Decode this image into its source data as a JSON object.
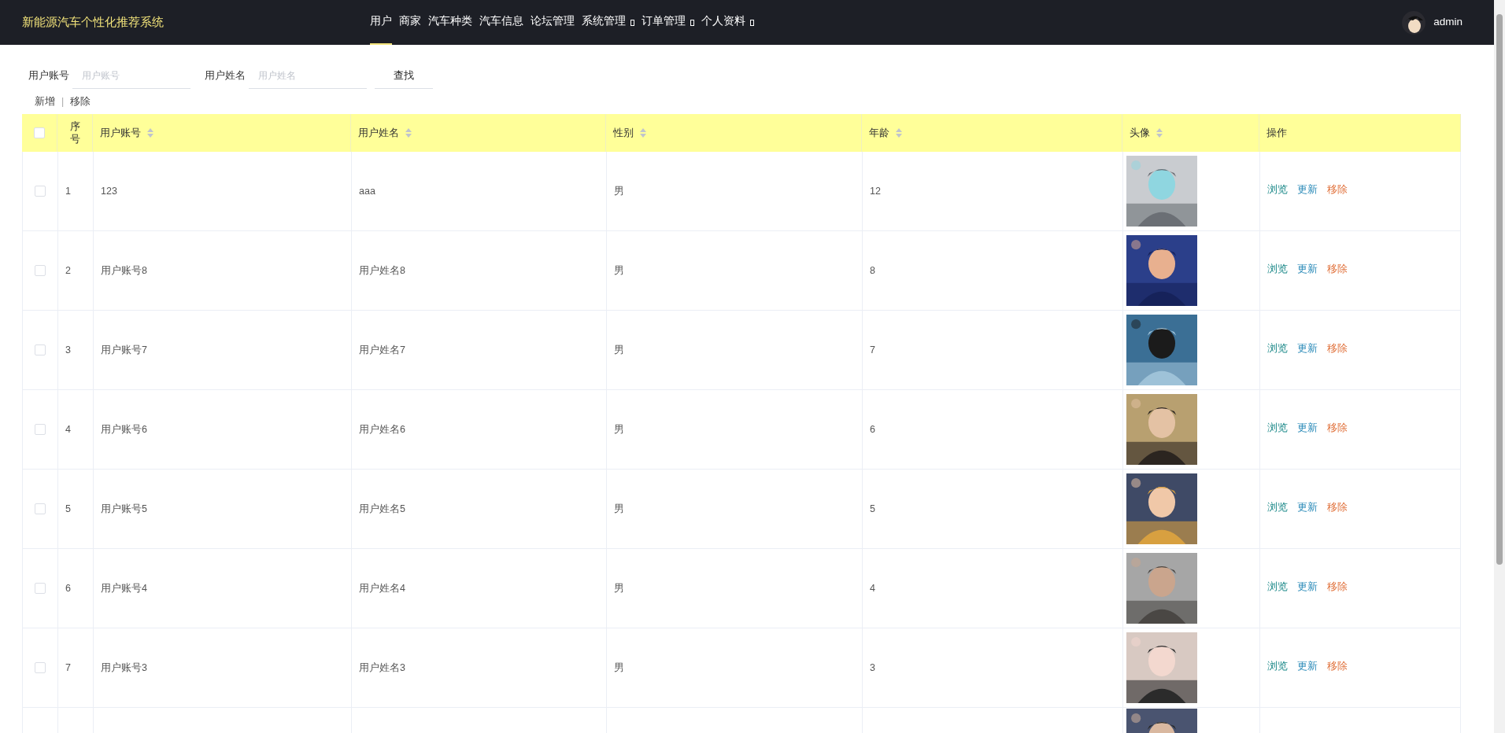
{
  "header": {
    "title": "新能源汽车个性化推荐系统",
    "nav": [
      {
        "label": "用户",
        "selected": true,
        "has_menu": false
      },
      {
        "label": "商家",
        "selected": false,
        "has_menu": false
      },
      {
        "label": "汽车种类",
        "selected": false,
        "has_menu": false
      },
      {
        "label": "汽车信息",
        "selected": false,
        "has_menu": false
      },
      {
        "label": "论坛管理",
        "selected": false,
        "has_menu": false
      },
      {
        "label": "系统管理",
        "selected": false,
        "has_menu": true
      },
      {
        "label": "订单管理",
        "selected": false,
        "has_menu": true
      },
      {
        "label": "个人资料",
        "selected": false,
        "has_menu": true
      }
    ],
    "user": "admin"
  },
  "search": {
    "fields": [
      {
        "label": "用户账号",
        "placeholder": "用户账号"
      },
      {
        "label": "用户姓名",
        "placeholder": "用户姓名"
      }
    ],
    "button": "查找"
  },
  "actions": {
    "add": "新增",
    "separator": "|",
    "remove": "移除"
  },
  "table": {
    "select_all": {
      "checked": false
    },
    "columns": [
      {
        "label": "序号",
        "sortable": false
      },
      {
        "label": "用户账号",
        "sortable": true
      },
      {
        "label": "用户姓名",
        "sortable": true
      },
      {
        "label": "性别",
        "sortable": true
      },
      {
        "label": "年龄",
        "sortable": true
      },
      {
        "label": "头像",
        "sortable": true
      },
      {
        "label": "操作",
        "sortable": false
      }
    ],
    "rows": [
      {
        "checked": false,
        "cells": [
          "1",
          "123",
          "aaa",
          "男",
          "12"
        ],
        "actions": [
          "浏览",
          "更新",
          "移除"
        ]
      },
      {
        "checked": false,
        "cells": [
          "2",
          "用户账号8",
          "用户姓名8",
          "男",
          "8"
        ],
        "actions": [
          "浏览",
          "更新",
          "移除"
        ]
      },
      {
        "checked": false,
        "cells": [
          "3",
          "用户账号7",
          "用户姓名7",
          "男",
          "7"
        ],
        "actions": [
          "浏览",
          "更新",
          "移除"
        ]
      },
      {
        "checked": false,
        "cells": [
          "4",
          "用户账号6",
          "用户姓名6",
          "男",
          "6"
        ],
        "actions": [
          "浏览",
          "更新",
          "移除"
        ]
      },
      {
        "checked": false,
        "cells": [
          "5",
          "用户账号5",
          "用户姓名5",
          "男",
          "5"
        ],
        "actions": [
          "浏览",
          "更新",
          "移除"
        ]
      },
      {
        "checked": false,
        "cells": [
          "6",
          "用户账号4",
          "用户姓名4",
          "男",
          "4"
        ],
        "actions": [
          "浏览",
          "更新",
          "移除"
        ]
      },
      {
        "checked": false,
        "cells": [
          "7",
          "用户账号3",
          "用户姓名3",
          "男",
          "3"
        ],
        "actions": [
          "浏览",
          "更新",
          "移除"
        ]
      }
    ]
  }
}
